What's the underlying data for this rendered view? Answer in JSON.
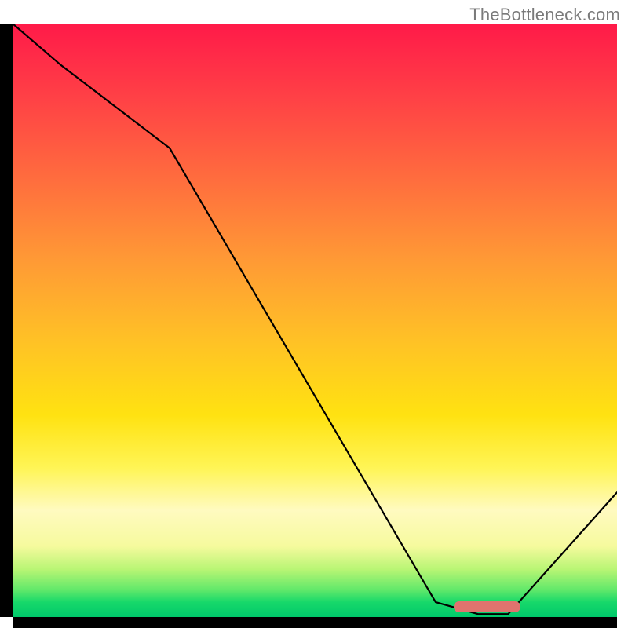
{
  "watermark": "TheBottleneck.com",
  "chart_data": {
    "type": "line",
    "title": "",
    "xlabel": "",
    "ylabel": "",
    "xlim": [
      0,
      100
    ],
    "ylim": [
      0,
      100
    ],
    "x": [
      0,
      8,
      26,
      70,
      77,
      82,
      100
    ],
    "values": [
      100,
      93,
      79,
      2.5,
      0.5,
      0.5,
      21
    ],
    "optimal_range_x": [
      73,
      84
    ],
    "gradient_note": "background encodes bottleneck severity: red=high, green=optimal"
  },
  "optimal_marker": {
    "left_pct": 73,
    "width_pct": 11,
    "bottom_pct": 0.8
  }
}
